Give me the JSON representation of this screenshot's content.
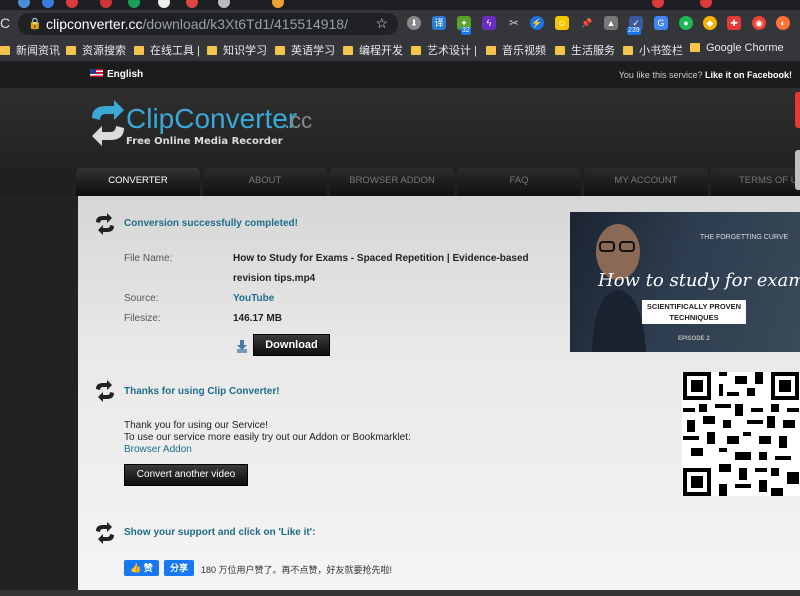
{
  "browser": {
    "url_host": "clipconverter.cc",
    "url_path": "/download/k3Xt6Td1/415514918/",
    "ext_badge_1": "32",
    "ext_badge_2": "239",
    "bookmarks": [
      {
        "label": "新闻资讯"
      },
      {
        "label": "资源搜索"
      },
      {
        "label": "在线工具 |"
      },
      {
        "label": "知识学习"
      },
      {
        "label": "英语学习"
      },
      {
        "label": "编程开发"
      },
      {
        "label": "艺术设计 |"
      },
      {
        "label": "音乐视频"
      },
      {
        "label": "生活服务"
      },
      {
        "label": "小书签栏"
      },
      {
        "label": "Google Chorme"
      }
    ]
  },
  "site": {
    "language": "English",
    "like_prefix": "You like this service?",
    "like_link": "Like it on Facebook!",
    "logo_main": "ClipConverter",
    "logo_suffix": ".cc",
    "tagline": "Free Online Media Recorder",
    "nav": [
      "CONVERTER",
      "ABOUT",
      "BROWSER ADDON",
      "FAQ",
      "MY ACCOUNT",
      "TERMS OF U"
    ]
  },
  "result": {
    "title": "Conversion successfully completed!",
    "file_name_label": "File Name:",
    "file_name_line1": "How to Study for Exams - Spaced Repetition | Evidence-based",
    "file_name_line2": "revision tips.mp4",
    "source_label": "Source:",
    "source_value": "YouTube",
    "filesize_label": "Filesize:",
    "filesize_value": "146.17 MB",
    "download_label": "Download"
  },
  "thumbnail": {
    "title": "How to study for exams",
    "subtitle_line1": "SCIENTIFICALLY PROVEN",
    "subtitle_line2": "TECHNIQUES",
    "episode": "EPISODE 2",
    "board_text": "THE FORGETTING CURVE"
  },
  "thanks": {
    "title": "Thanks for using Clip Converter!",
    "line1": "Thank you for using our Service!",
    "line2": "To use our service more easily try out our Addon or Bookmarklet:",
    "addon_link": "Browser Addon",
    "convert_button": "Convert another video"
  },
  "support": {
    "title": "Show your support and click on 'Like it':",
    "like_button": "赞",
    "share_button": "分享",
    "like_count_text": "180 万位用户赞了。再不点赞，好友就要抢先啦!"
  },
  "colors": {
    "accent_blue": "#1f6d8a",
    "facebook_blue": "#1877f2",
    "dark_bg": "#222222"
  }
}
